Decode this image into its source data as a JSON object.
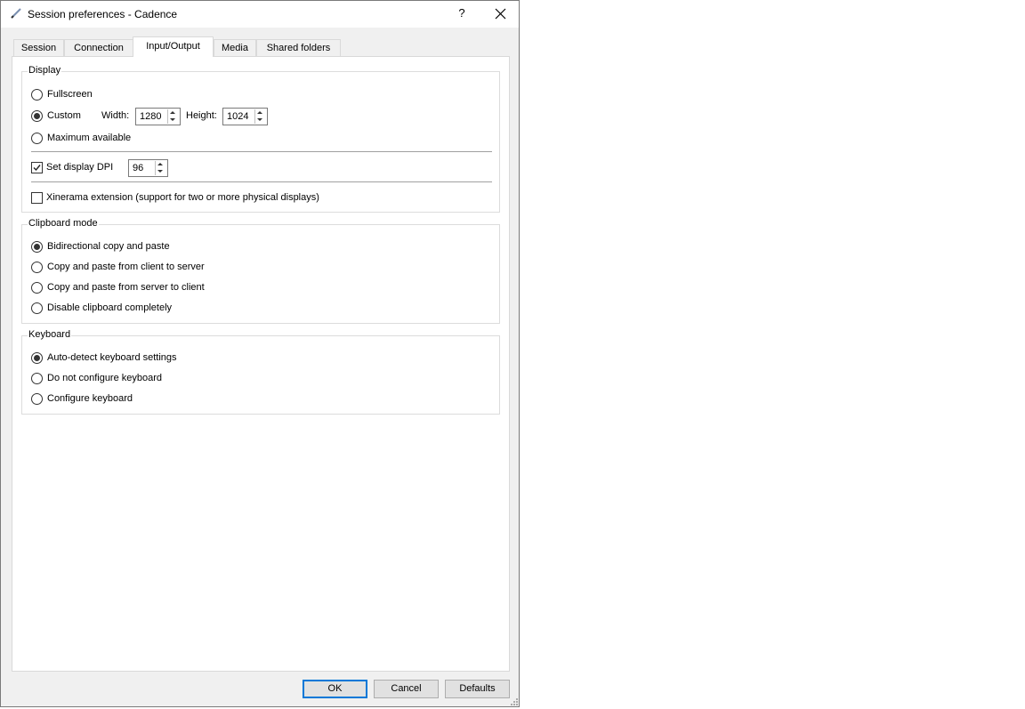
{
  "window": {
    "title": "Session preferences - Cadence",
    "help_label": "?",
    "close_label": "✕"
  },
  "tabs": [
    {
      "label": "Session"
    },
    {
      "label": "Connection"
    },
    {
      "label": "Input/Output",
      "active": true
    },
    {
      "label": "Media"
    },
    {
      "label": "Shared folders"
    }
  ],
  "display": {
    "title": "Display",
    "fullscreen": "Fullscreen",
    "custom": "Custom",
    "width_label": "Width:",
    "width_value": "1280",
    "height_label": "Height:",
    "height_value": "1024",
    "maximum": "Maximum available",
    "selected": "custom",
    "dpi_label": "Set display DPI",
    "dpi_checked": true,
    "dpi_value": "96",
    "xinerama_label": "Xinerama extension (support for two or more physical displays)",
    "xinerama_checked": false
  },
  "clipboard": {
    "title": "Clipboard mode",
    "options": [
      "Bidirectional copy and paste",
      "Copy and paste from client to server",
      "Copy and paste from server to client",
      "Disable clipboard completely"
    ],
    "selected_index": 0
  },
  "keyboard": {
    "title": "Keyboard",
    "options": [
      "Auto-detect keyboard settings",
      "Do not configure keyboard",
      "Configure keyboard"
    ],
    "selected_index": 0
  },
  "buttons": {
    "ok": "OK",
    "cancel": "Cancel",
    "defaults": "Defaults"
  }
}
